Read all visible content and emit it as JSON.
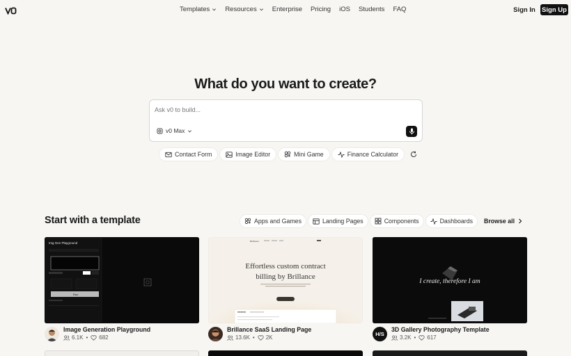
{
  "nav": {
    "logo": "v0",
    "links": [
      {
        "label": "Templates",
        "dropdown": true
      },
      {
        "label": "Resources",
        "dropdown": true
      },
      {
        "label": "Enterprise",
        "dropdown": false
      },
      {
        "label": "Pricing",
        "dropdown": false
      },
      {
        "label": "iOS",
        "dropdown": false
      },
      {
        "label": "Students",
        "dropdown": false
      },
      {
        "label": "FAQ",
        "dropdown": false
      }
    ],
    "sign_in": "Sign In",
    "sign_up": "Sign Up"
  },
  "hero": {
    "title": "What do you want to create?",
    "prompt_placeholder": "Ask v0 to build...",
    "model": "v0 Max",
    "suggestions": [
      {
        "label": "Contact Form",
        "icon": "mail-icon"
      },
      {
        "label": "Image Editor",
        "icon": "image-icon"
      },
      {
        "label": "Mini Game",
        "icon": "game-icon"
      },
      {
        "label": "Finance Calculator",
        "icon": "activity-icon"
      }
    ]
  },
  "templates": {
    "title": "Start with a template",
    "filters": [
      {
        "label": "Apps and Games",
        "icon": "apps-icon"
      },
      {
        "label": "Landing Pages",
        "icon": "layout-icon"
      },
      {
        "label": "Components",
        "icon": "grid-icon"
      },
      {
        "label": "Dashboards",
        "icon": "activity-icon"
      }
    ],
    "browse_all": "Browse all",
    "cards": [
      {
        "title": "Image Generation Playground",
        "views": "6.1K",
        "likes": "682",
        "thumb_title": "Img Gen Playground",
        "thumb_button": "Run"
      },
      {
        "title": "Brillance SaaS Landing Page",
        "views": "13.6K",
        "likes": "2K",
        "thumb_brand": "Brillance",
        "thumb_headline_1": "Effortless custom contract",
        "thumb_headline_2": "billing by Brillance"
      },
      {
        "title": "3D Gallery Photography Template",
        "views": "3.2K",
        "likes": "617",
        "avatar_text": "H/S",
        "thumb_text": "I create, therefore I am"
      }
    ]
  },
  "colors": {
    "background": "#f7f6f3",
    "primary": "#111111",
    "text": "#1a1a1a",
    "muted": "#555555"
  }
}
